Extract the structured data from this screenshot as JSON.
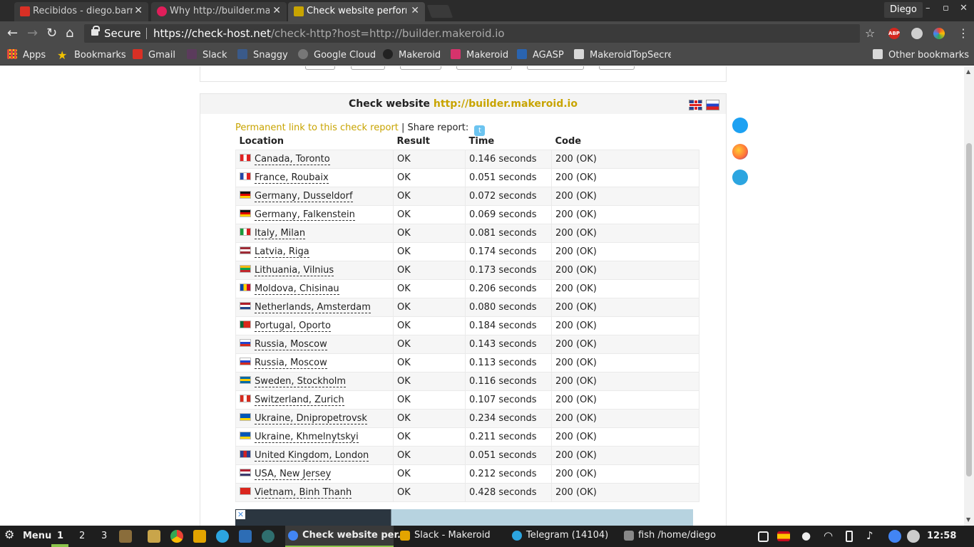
{
  "browser": {
    "tabs": [
      {
        "title": "Recibidos - diego.barre",
        "active": false,
        "favicon_color": "#d93025"
      },
      {
        "title": "Why http://builder.ma",
        "active": false,
        "favicon_color": "#e01e5a"
      },
      {
        "title": "Check website perform",
        "active": true,
        "favicon_color": "#c8a400"
      }
    ],
    "profile_name": "Diego",
    "window_controls": {
      "minimize": "–",
      "maximize": "▫",
      "close": "✕"
    },
    "security_label": "Secure",
    "url_host": "https://check-host.net",
    "url_path": "/check-http?host=http://builder.makeroid.io",
    "abp_label": "ABP"
  },
  "bookmarks": [
    {
      "label": "Apps",
      "icon": "apps-grid-icon",
      "color": "#e24a3b"
    },
    {
      "label": "Bookmarks",
      "icon": "star-icon",
      "color": "#f2c200"
    },
    {
      "label": "Gmail",
      "icon": "gmail-icon",
      "color": "#d93025"
    },
    {
      "label": "Slack",
      "icon": "slack-icon",
      "color": "#5b3b5c"
    },
    {
      "label": "Snaggy",
      "icon": "snaggy-icon",
      "color": "#3a5a8a"
    },
    {
      "label": "Google Cloud",
      "icon": "gear-icon",
      "color": "#777777"
    },
    {
      "label": "Makeroid",
      "icon": "github-icon",
      "color": "#222222"
    },
    {
      "label": "Makeroid",
      "icon": "makeroid-icon",
      "color": "#d6336c"
    },
    {
      "label": "AGASP",
      "icon": "shield-icon",
      "color": "#2a64b0"
    },
    {
      "label": "MakeroidTopSecret",
      "icon": "folder-icon",
      "color": "#d8d8d8"
    }
  ],
  "other_bookmarks": "Other bookmarks",
  "panel": {
    "title_prefix": "Check website",
    "title_link": "http://builder.makeroid.io",
    "permanent_link": "Permanent link to this check report",
    "share_label": "| Share report:"
  },
  "table": {
    "headers": [
      "Location",
      "Result",
      "Time",
      "Code"
    ],
    "rows": [
      {
        "location": "Canada, Toronto",
        "result": "OK",
        "time": "0.146 seconds",
        "code": "200 (OK)",
        "flag": [
          "#e02020",
          "#ffffff",
          "#e02020"
        ]
      },
      {
        "location": "France, Roubaix",
        "result": "OK",
        "time": "0.051 seconds",
        "code": "200 (OK)",
        "flag": [
          "#2446a8",
          "#ffffff",
          "#e02020"
        ]
      },
      {
        "location": "Germany, Dusseldorf",
        "result": "OK",
        "time": "0.072 seconds",
        "code": "200 (OK)",
        "flag": [
          "#111111",
          "#dd0000",
          "#ffce00"
        ],
        "h": true
      },
      {
        "location": "Germany, Falkenstein",
        "result": "OK",
        "time": "0.069 seconds",
        "code": "200 (OK)",
        "flag": [
          "#111111",
          "#dd0000",
          "#ffce00"
        ],
        "h": true
      },
      {
        "location": "Italy, Milan",
        "result": "OK",
        "time": "0.081 seconds",
        "code": "200 (OK)",
        "flag": [
          "#1a9a3a",
          "#ffffff",
          "#d62020"
        ]
      },
      {
        "location": "Latvia, Riga",
        "result": "OK",
        "time": "0.174 seconds",
        "code": "200 (OK)",
        "flag": [
          "#9e2b36",
          "#ffffff",
          "#9e2b36"
        ],
        "h": true
      },
      {
        "location": "Lithuania, Vilnius",
        "result": "OK",
        "time": "0.173 seconds",
        "code": "200 (OK)",
        "flag": [
          "#fdb913",
          "#00a651",
          "#c1272d"
        ],
        "h": true
      },
      {
        "location": "Moldova, Chisinau",
        "result": "OK",
        "time": "0.206 seconds",
        "code": "200 (OK)",
        "flag": [
          "#0046ae",
          "#ffd200",
          "#cc092f"
        ]
      },
      {
        "location": "Netherlands, Amsterdam",
        "result": "OK",
        "time": "0.080 seconds",
        "code": "200 (OK)",
        "flag": [
          "#ae1c28",
          "#ffffff",
          "#21468b"
        ],
        "h": true
      },
      {
        "location": "Portugal, Oporto",
        "result": "OK",
        "time": "0.184 seconds",
        "code": "200 (OK)",
        "flag": [
          "#046a38",
          "#da291c",
          "#da291c"
        ]
      },
      {
        "location": "Russia, Moscow",
        "result": "OK",
        "time": "0.143 seconds",
        "code": "200 (OK)",
        "flag": [
          "#ffffff",
          "#2244cc",
          "#d52b1e"
        ],
        "h": true
      },
      {
        "location": "Russia, Moscow",
        "result": "OK",
        "time": "0.113 seconds",
        "code": "200 (OK)",
        "flag": [
          "#ffffff",
          "#2244cc",
          "#d52b1e"
        ],
        "h": true
      },
      {
        "location": "Sweden, Stockholm",
        "result": "OK",
        "time": "0.116 seconds",
        "code": "200 (OK)",
        "flag": [
          "#006aa7",
          "#fecc00",
          "#006aa7"
        ],
        "h": true
      },
      {
        "location": "Switzerland, Zurich",
        "result": "OK",
        "time": "0.107 seconds",
        "code": "200 (OK)",
        "flag": [
          "#d52b1e",
          "#ffffff",
          "#d52b1e"
        ]
      },
      {
        "location": "Ukraine, Dnipropetrovsk",
        "result": "OK",
        "time": "0.234 seconds",
        "code": "200 (OK)",
        "flag": [
          "#0057b7",
          "#0057b7",
          "#ffd700"
        ],
        "h": true
      },
      {
        "location": "Ukraine, Khmelnytskyi",
        "result": "OK",
        "time": "0.211 seconds",
        "code": "200 (OK)",
        "flag": [
          "#0057b7",
          "#0057b7",
          "#ffd700"
        ],
        "h": true
      },
      {
        "location": "United Kingdom, London",
        "result": "OK",
        "time": "0.051 seconds",
        "code": "200 (OK)",
        "flag": [
          "#2a3f8f",
          "#d22222",
          "#2a3f8f"
        ]
      },
      {
        "location": "USA, New Jersey",
        "result": "OK",
        "time": "0.212 seconds",
        "code": "200 (OK)",
        "flag": [
          "#b22234",
          "#ffffff",
          "#3c3b6e"
        ],
        "h": true
      },
      {
        "location": "Vietnam, Binh Thanh",
        "result": "OK",
        "time": "0.428 seconds",
        "code": "200 (OK)",
        "flag": [
          "#da251d",
          "#da251d",
          "#da251d"
        ]
      }
    ]
  },
  "taskbar": {
    "menu_label": "Menu",
    "workspaces": [
      "1",
      "2",
      "3"
    ],
    "windows": [
      {
        "title": "Check website per...",
        "active": true,
        "color": "#4285f4"
      },
      {
        "title": "Slack - Makeroid",
        "active": false,
        "color": "#e3a400"
      },
      {
        "title": "Telegram (14104)",
        "active": false,
        "color": "#2ca5e0"
      },
      {
        "title": "fish  /home/diego",
        "active": false,
        "color": "#888888"
      }
    ],
    "clock": "12:58"
  },
  "colors": {
    "accent_link": "#c8a400",
    "twitter": "#1da1f2",
    "telegram": "#2ca5e0",
    "firefox": "#ff7139"
  }
}
